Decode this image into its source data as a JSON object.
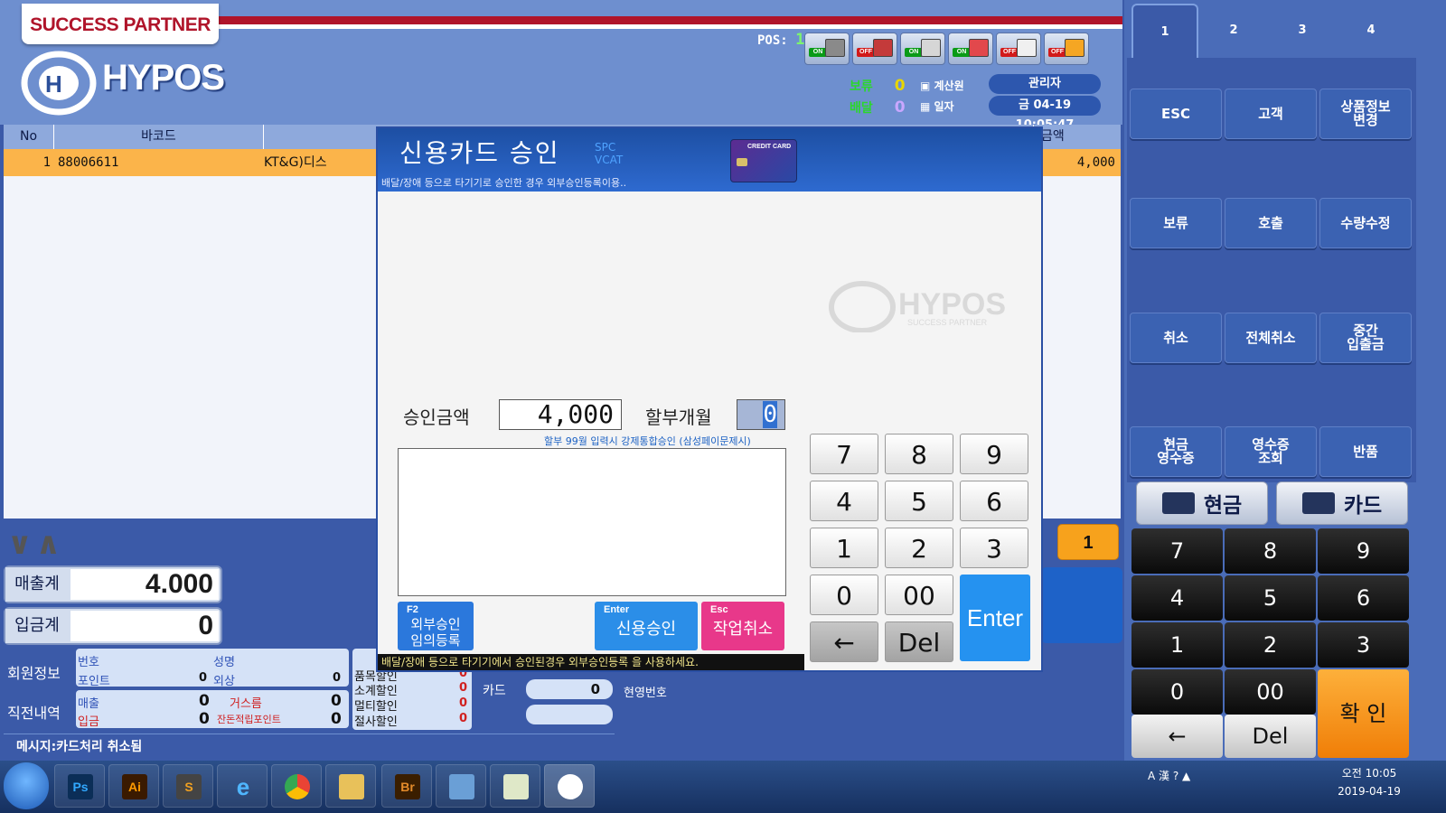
{
  "header": {
    "tagline": "SUCCESS PARTNER",
    "logo": "HYPOS",
    "pos_label": "POS:",
    "pos_number": "15",
    "status_icons": [
      {
        "name": "printer-icon",
        "state": "ON"
      },
      {
        "name": "scanner-icon",
        "state": "OFF"
      },
      {
        "name": "network-icon",
        "state": "ON"
      },
      {
        "name": "card-reader-icon",
        "state": "ON"
      },
      {
        "name": "delivery-truck-icon",
        "state": "OFF"
      },
      {
        "name": "ok-icon",
        "state": "OFF"
      }
    ],
    "hold_label": "보류",
    "hold_count": "0",
    "delivery_label": "배달",
    "delivery_count": "0",
    "cashier_label": "계산원",
    "cashier_value": "관리자",
    "date_label": "일자",
    "date_value": "금 04-19 10:05:47"
  },
  "table": {
    "columns": [
      "No",
      "바코드",
      "",
      "금액"
    ],
    "rows": [
      {
        "no": "1",
        "barcode": "88006611",
        "name": "KT&G)디스",
        "amount": "4,000"
      }
    ]
  },
  "totals": {
    "sales_label": "매출계",
    "sales_value": "4.000",
    "payment_label": "입금계",
    "payment_value": "0",
    "badge": "1"
  },
  "member_info": {
    "label": "회원정보",
    "number_label": "번호",
    "name_label": "성명",
    "points_label": "포인트",
    "points_value": "0",
    "credit_label": "외상",
    "credit_value": "0"
  },
  "recent": {
    "label": "직전내역",
    "sales_label": "매출",
    "sales_value": "0",
    "payment_label": "입금",
    "payment_value": "0",
    "change_label": "거스름",
    "change_value": "0",
    "points_label": "잔돈적립포인트",
    "points_value": "0"
  },
  "discounts": [
    {
      "label": "품목할인",
      "value": "0"
    },
    {
      "label": "소계할인",
      "value": "0"
    },
    {
      "label": "멀티할인",
      "value": "0"
    },
    {
      "label": "절사할인",
      "value": "0"
    }
  ],
  "card_summary": {
    "label": "카드",
    "value": "0",
    "cash_receipt_label": "현영번호"
  },
  "message": "메시지:카드처리 취소됨",
  "dialog": {
    "title": "신용카드 승인",
    "vendor_line1": "SPC",
    "vendor_line2": "VCAT",
    "subtitle": "배달/장애 등으로 타기기로 승인한 경우 외부승인등록이용..",
    "card_icon_text": "CREDIT CARD",
    "watermark": "HYPOS",
    "watermark_sub": "SUCCESS PARTNER",
    "amount_label": "승인금액",
    "amount_value": "4,000",
    "installment_label": "할부개월",
    "installment_value": "0",
    "installment_note": "할부 99월 입력시 강제통합승인 (삼성페이문제시)",
    "buttons": [
      {
        "key": "F2",
        "label": "외부승인\n임의등록"
      },
      {
        "key": "Enter",
        "label": "신용승인"
      },
      {
        "key": "Esc",
        "label": "작업취소"
      }
    ],
    "warning": "배달/장애 등으로 타기기에서 승인된경우 외부승인등록 을 사용하세요.",
    "keypad": [
      "7",
      "8",
      "9",
      "4",
      "5",
      "6",
      "1",
      "2",
      "3",
      "0",
      "00",
      "←",
      "Del"
    ],
    "enter_label": "Enter"
  },
  "right_panel": {
    "tabs": [
      "1",
      "2",
      "3",
      "4"
    ],
    "functions": [
      "ESC",
      "고객",
      "상품정보\n변경",
      "보류",
      "호출",
      "수량수정",
      "취소",
      "전체취소",
      "중간\n입출금",
      "현금\n영수증",
      "영수증\n조회",
      "반품"
    ],
    "cash_label": "현금",
    "card_label": "카드",
    "keypad": [
      "7",
      "8",
      "9",
      "4",
      "5",
      "6",
      "1",
      "2",
      "3",
      "0",
      "00",
      "←",
      "Del"
    ],
    "confirm_label": "확 인"
  },
  "taskbar": {
    "apps": [
      "Ps",
      "Ai",
      "S",
      "e",
      "chrome",
      "folder",
      "Br",
      "photo",
      "notes",
      "hypos"
    ],
    "ime": "A 漢",
    "time": "오전 10:05",
    "date": "2019-04-19"
  },
  "colors": {
    "accent_blue": "#2592f0",
    "selected_row": "#fbb44a",
    "cancel_pink": "#e8388a",
    "brand_red": "#b0142a"
  }
}
